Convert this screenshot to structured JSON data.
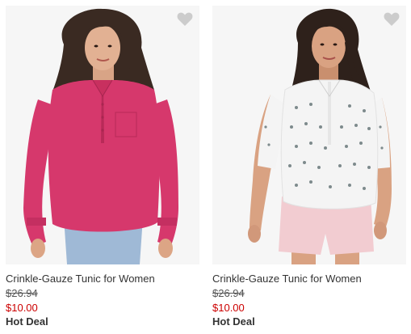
{
  "products": [
    {
      "name": "Crinkle-Gauze Tunic for Women",
      "original_price": "$26.94",
      "sale_price": "$10.00",
      "badge": "Hot Deal",
      "favorite_icon": "heart-icon",
      "shirt_color": "#d6386c"
    },
    {
      "name": "Crinkle-Gauze Tunic for Women",
      "original_price": "$26.94",
      "sale_price": "$10.00",
      "badge": "Hot Deal",
      "favorite_icon": "heart-icon",
      "shirt_color": "#f4f4f4"
    }
  ],
  "colors": {
    "sale_price": "#cc0000",
    "heart": "#cccccc"
  }
}
